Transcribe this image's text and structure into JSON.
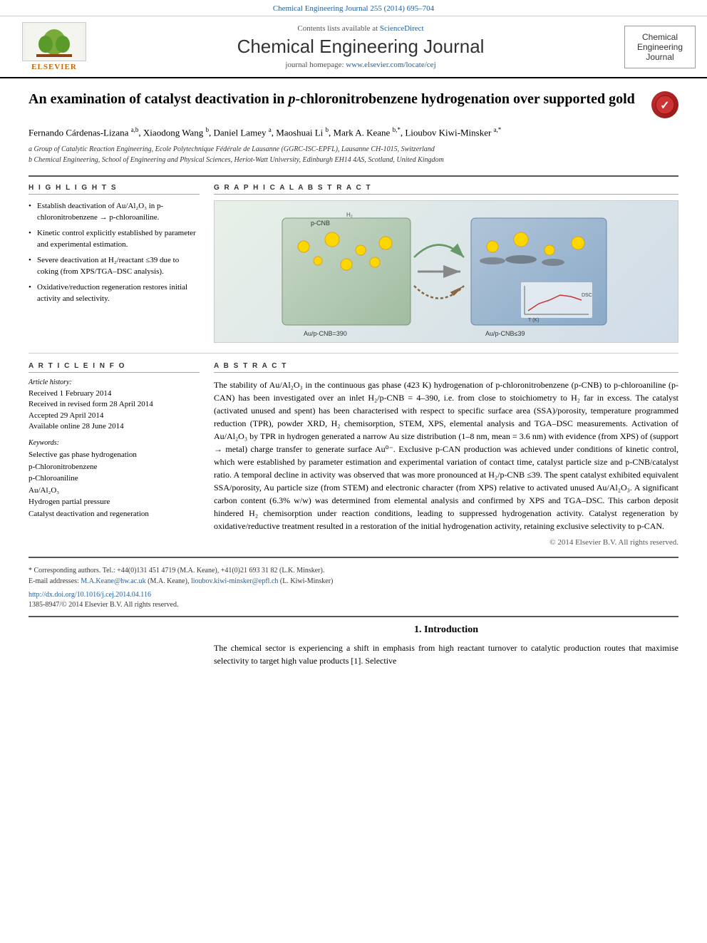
{
  "journal": {
    "citation": "Chemical Engineering Journal 255 (2014) 695–704",
    "sciencedirect_text": "Contents lists available at",
    "sciencedirect_link": "ScienceDirect",
    "title": "Chemical Engineering Journal",
    "homepage_text": "journal homepage: www.elsevier.com/locate/cej",
    "homepage_link": "www.elsevier.com/locate/cej",
    "sidebar_title": "Chemical\nEngineering\nJournal",
    "elsevier_text": "ELSEVIER"
  },
  "article": {
    "title_prefix": "An examination of catalyst deactivation in ",
    "title_italic": "p",
    "title_suffix": "-chloronitrobenzene hydrogenation over supported gold",
    "crossmark": "✓",
    "authors": "Fernando Cárdenas-Lizana a,b, Xiaodong Wang b, Daniel Lamey a, Maoshuai Li b, Mark A. Keane b,*, Lioubov Kiwi-Minsker a,*",
    "affiliation_a": "a Group of Catalytic Reaction Engineering, Ecole Polytechnique Fédérale de Lausanne (GGRC-ISC-EPFL), Lausanne CH-1015, Switzerland",
    "affiliation_b": "b Chemical Engineering, School of Engineering and Physical Sciences, Heriot-Watt University, Edinburgh EH14 4AS, Scotland, United Kingdom"
  },
  "highlights": {
    "heading": "H I G H L I G H T S",
    "items": [
      "Establish deactivation of Au/Al₂O₃ in p-chloronitrobenzene → p-chloroaniline.",
      "Kinetic control explicitly established by parameter and experimental estimation.",
      "Severe deactivation at H₂/reactant ≤39 due to coking (from XPS/TGA–DSC analysis).",
      "Oxidative/reduction regeneration restores initial activity and selectivity."
    ]
  },
  "graphical_abstract": {
    "heading": "G R A P H I C A L   A B S T R A C T"
  },
  "article_info": {
    "heading": "A R T I C L E   I N F O",
    "history_label": "Article history:",
    "received": "Received 1 February 2014",
    "revised": "Received in revised form 28 April 2014",
    "accepted": "Accepted 29 April 2014",
    "available": "Available online 28 June 2014",
    "keywords_label": "Keywords:",
    "keywords": [
      "Selective gas phase hydrogenation",
      "p-Chloronitrobenzene",
      "p-Chloroaniline",
      "Au/Al₂O₃",
      "Hydrogen partial pressure",
      "Catalyst deactivation and regeneration"
    ]
  },
  "abstract": {
    "heading": "A B S T R A C T",
    "text": "The stability of Au/Al₂O₃ in the continuous gas phase (423 K) hydrogenation of p-chloronitrobenzene (p-CNB) to p-chloroaniline (p-CAN) has been investigated over an inlet H₂/p-CNB = 4–390, i.e. from close to stoichiometry to H₂ far in excess. The catalyst (activated unused and spent) has been characterised with respect to specific surface area (SSA)/porosity, temperature programmed reduction (TPR), powder XRD, H₂ chemisorption, STEM, XPS, elemental analysis and TGA–DSC measurements. Activation of Au/Al₂O₃ by TPR in hydrogen generated a narrow Au size distribution (1–8 nm, mean = 3.6 nm) with evidence (from XPS) of (support → metal) charge transfer to generate surface Au⁰⁻. Exclusive p-CAN production was achieved under conditions of kinetic control, which were established by parameter estimation and experimental variation of contact time, catalyst particle size and p-CNB/catalyst ratio. A temporal decline in activity was observed that was more pronounced at H₂/p-CNB ≤39. The spent catalyst exhibited equivalent SSA/porosity, Au particle size (from STEM) and electronic character (from XPS) relative to activated unused Au/Al₂O₃. A significant carbon content (6.3% w/w) was determined from elemental analysis and confirmed by XPS and TGA–DSC. This carbon deposit hindered H₂ chemisorption under reaction conditions, leading to suppressed hydrogenation activity. Catalyst regeneration by oxidative/reductive treatment resulted in a restoration of the initial hydrogenation activity, retaining exclusive selectivity to p-CAN.",
    "copyright": "© 2014 Elsevier B.V. All rights reserved."
  },
  "footnotes": {
    "corresponding": "* Corresponding authors. Tel.: +44(0)131 451 4719 (M.A. Keane), +41(0)21 693 31 82 (L.K. Minsker).",
    "email_label": "E-mail addresses:",
    "email1": "M.A.Keane@hw.ac.uk",
    "email1_name": "M.A. Keane",
    "email2": "lioubov.kiwi-minsker@epfl.ch",
    "email2_name": "L. Kiwi-Minsker",
    "doi": "http://dx.doi.org/10.1016/j.cej.2014.04.116",
    "issn": "1385-8947/© 2014 Elsevier B.V. All rights reserved."
  },
  "introduction": {
    "heading": "1. Introduction",
    "text": "The chemical sector is experiencing a shift in emphasis from high reactant turnover to catalytic production routes that maximise selectivity to target high value products [1]. Selective"
  }
}
